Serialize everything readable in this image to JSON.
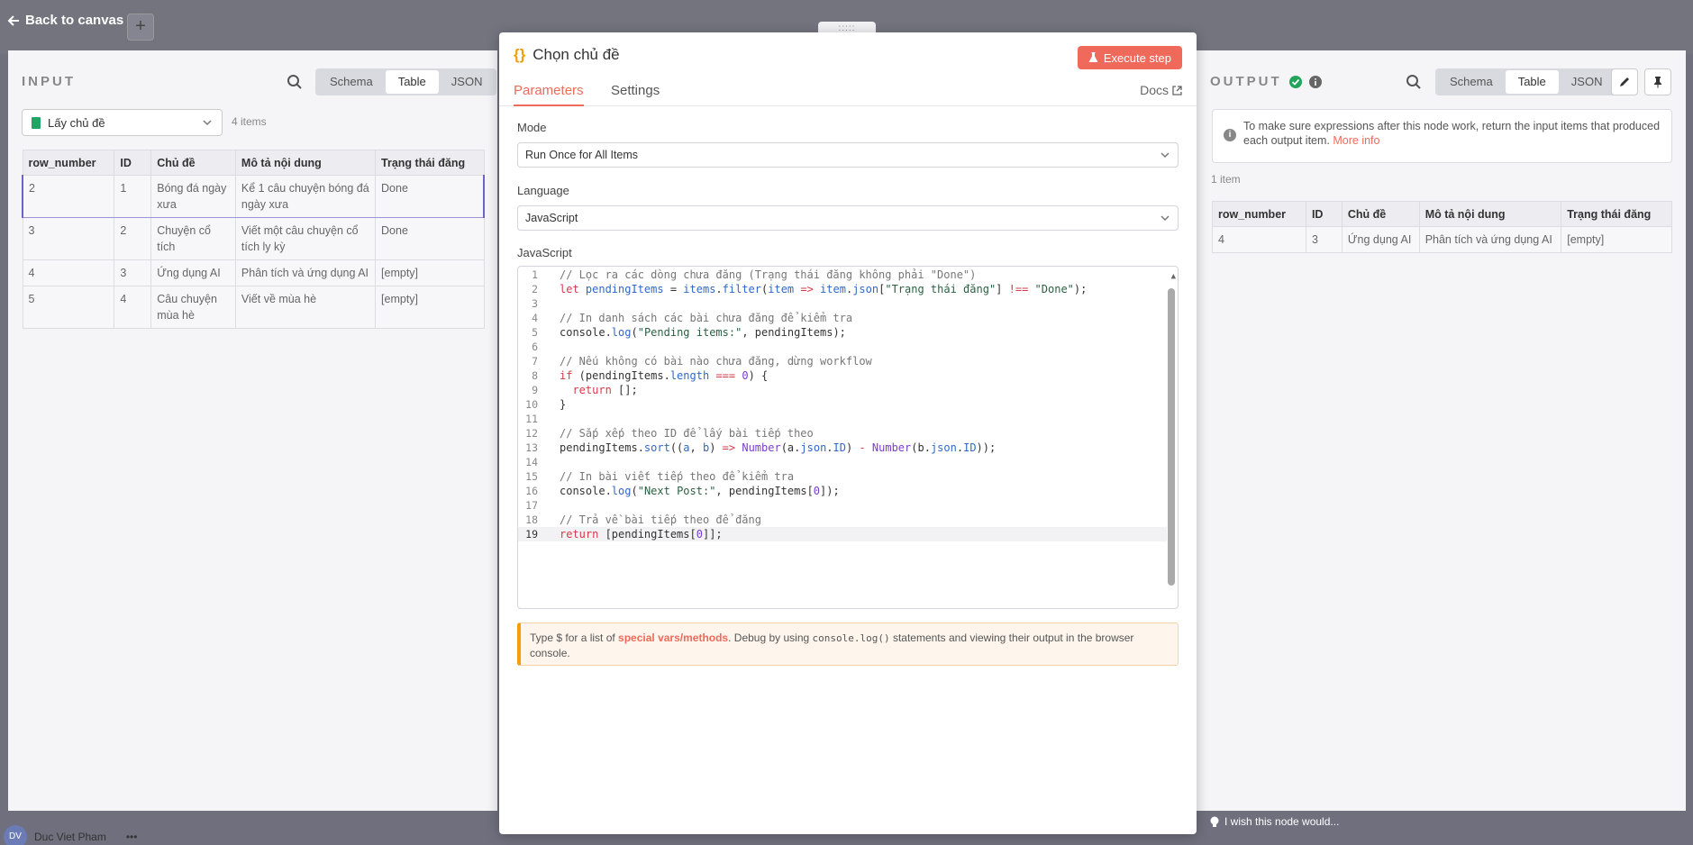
{
  "canvas": {
    "back_label": "Back to canvas",
    "add_label": "+",
    "user_initials": "DV",
    "user_name": "Duc Viet Pham",
    "user_menu": "•••",
    "feedback_label": "I wish this node would..."
  },
  "input": {
    "title": "INPUT",
    "views": [
      "Schema",
      "Table",
      "JSON"
    ],
    "active_view": "Table",
    "source_node": "Lấy chủ đề",
    "items_count": "4 items",
    "columns": [
      "row_number",
      "ID",
      "Chủ đề",
      "Mô tả nội dung",
      "Trạng thái đăng"
    ],
    "rows": [
      [
        "2",
        "1",
        "Bóng đá ngày xưa",
        "Kể 1 câu chuyện bóng đá ngày xưa",
        "Done"
      ],
      [
        "3",
        "2",
        "Chuyện cổ tích",
        "Viết một câu chuyện cổ tích ly kỳ",
        "Done"
      ],
      [
        "4",
        "3",
        "Ứng dụng AI",
        "Phân tích và ứng dụng AI",
        "[empty]"
      ],
      [
        "5",
        "4",
        "Câu chuyện mùa hè",
        "Viết về mùa hè",
        "[empty]"
      ]
    ]
  },
  "node": {
    "drag_handle": ":::::",
    "icon": "{}",
    "title": "Chọn chủ đề",
    "execute_label": "Execute step",
    "tabs": [
      "Parameters",
      "Settings"
    ],
    "active_tab": "Parameters",
    "docs_label": "Docs",
    "mode_label": "Mode",
    "mode_value": "Run Once for All Items",
    "language_label": "Language",
    "language_value": "JavaScript",
    "code_label": "JavaScript",
    "active_line": 19,
    "code_lines": [
      [
        [
          "com",
          "// Lọc ra các dòng chưa đăng (Trạng thái đăng không phải \"Done\")"
        ]
      ],
      [
        [
          "kw",
          "let "
        ],
        [
          "var",
          "pendingItems"
        ],
        [
          "",
          " = "
        ],
        [
          "var",
          "items"
        ],
        [
          "",
          "."
        ],
        [
          "fn",
          "filter"
        ],
        [
          "",
          "("
        ],
        [
          "var",
          "item"
        ],
        [
          "kw",
          " => "
        ],
        [
          "var",
          "item"
        ],
        [
          "",
          "."
        ],
        [
          "var",
          "json"
        ],
        [
          "",
          "["
        ],
        [
          "str",
          "\"Trạng thái đăng\""
        ],
        [
          "",
          "] "
        ],
        [
          "kw",
          "!=="
        ],
        [
          "",
          " "
        ],
        [
          "str",
          "\"Done\""
        ],
        [
          "",
          ");"
        ]
      ],
      [],
      [
        [
          "com",
          "// In danh sách các bài chưa đăng để kiểm tra"
        ]
      ],
      [
        [
          "",
          "console."
        ],
        [
          "fn",
          "log"
        ],
        [
          "",
          "("
        ],
        [
          "str",
          "\"Pending items:\""
        ],
        [
          "",
          ", pendingItems);"
        ]
      ],
      [],
      [
        [
          "com",
          "// Nếu không có bài nào chưa đăng, dừng workflow"
        ]
      ],
      [
        [
          "kw",
          "if"
        ],
        [
          "",
          " (pendingItems."
        ],
        [
          "var",
          "length"
        ],
        [
          "",
          " "
        ],
        [
          "kw",
          "==="
        ],
        [
          "",
          " "
        ],
        [
          "num",
          "0"
        ],
        [
          "",
          ") {"
        ]
      ],
      [
        [
          "",
          "  "
        ],
        [
          "kw",
          "return"
        ],
        [
          "",
          " [];"
        ]
      ],
      [
        [
          "",
          "}"
        ]
      ],
      [],
      [
        [
          "com",
          "// Sắp xếp theo ID để lấy bài tiếp theo"
        ]
      ],
      [
        [
          "",
          "pendingItems."
        ],
        [
          "fn",
          "sort"
        ],
        [
          "",
          "(("
        ],
        [
          "var",
          "a"
        ],
        [
          "",
          ", "
        ],
        [
          "var",
          "b"
        ],
        [
          "",
          ") "
        ],
        [
          "kw",
          "=>"
        ],
        [
          "",
          " "
        ],
        [
          "cls",
          "Number"
        ],
        [
          "",
          "(a."
        ],
        [
          "var",
          "json"
        ],
        [
          "",
          "."
        ],
        [
          "var",
          "ID"
        ],
        [
          "",
          ") "
        ],
        [
          "kw",
          "-"
        ],
        [
          "",
          " "
        ],
        [
          "cls",
          "Number"
        ],
        [
          "",
          "(b."
        ],
        [
          "var",
          "json"
        ],
        [
          "",
          "."
        ],
        [
          "var",
          "ID"
        ],
        [
          "",
          "));"
        ]
      ],
      [],
      [
        [
          "com",
          "// In bài viết tiếp theo để kiểm tra"
        ]
      ],
      [
        [
          "",
          "console."
        ],
        [
          "fn",
          "log"
        ],
        [
          "",
          "("
        ],
        [
          "str",
          "\"Next Post:\""
        ],
        [
          "",
          ", pendingItems["
        ],
        [
          "num",
          "0"
        ],
        [
          "",
          "]);"
        ]
      ],
      [],
      [
        [
          "com",
          "// Trả về bài tiếp theo để đăng"
        ]
      ],
      [
        [
          "kw",
          "return"
        ],
        [
          "",
          " [pendingItems["
        ],
        [
          "num",
          "0"
        ],
        [
          "",
          "]];"
        ]
      ]
    ],
    "hint_pre": "Type $ for a list of ",
    "hint_link": "special vars/methods",
    "hint_mid": ". Debug by using ",
    "hint_code": "console.log()",
    "hint_post": " statements and viewing their output in the browser console."
  },
  "output": {
    "title": "OUTPUT",
    "views": [
      "Schema",
      "Table",
      "JSON"
    ],
    "active_view": "Table",
    "info_text": "To make sure expressions after this node work, return the input items that produced each output item. ",
    "info_link": "More info",
    "items_count": "1 item",
    "columns": [
      "row_number",
      "ID",
      "Chủ đề",
      "Mô tả nội dung",
      "Trạng thái đăng"
    ],
    "rows": [
      [
        "4",
        "3",
        "Ứng dụng AI",
        "Phân tích và ứng dụng AI",
        "[empty]"
      ]
    ]
  },
  "colors": {
    "accent": "#ef6a5a",
    "success": "#22a55b",
    "backdrop": "#6f6f7d"
  }
}
